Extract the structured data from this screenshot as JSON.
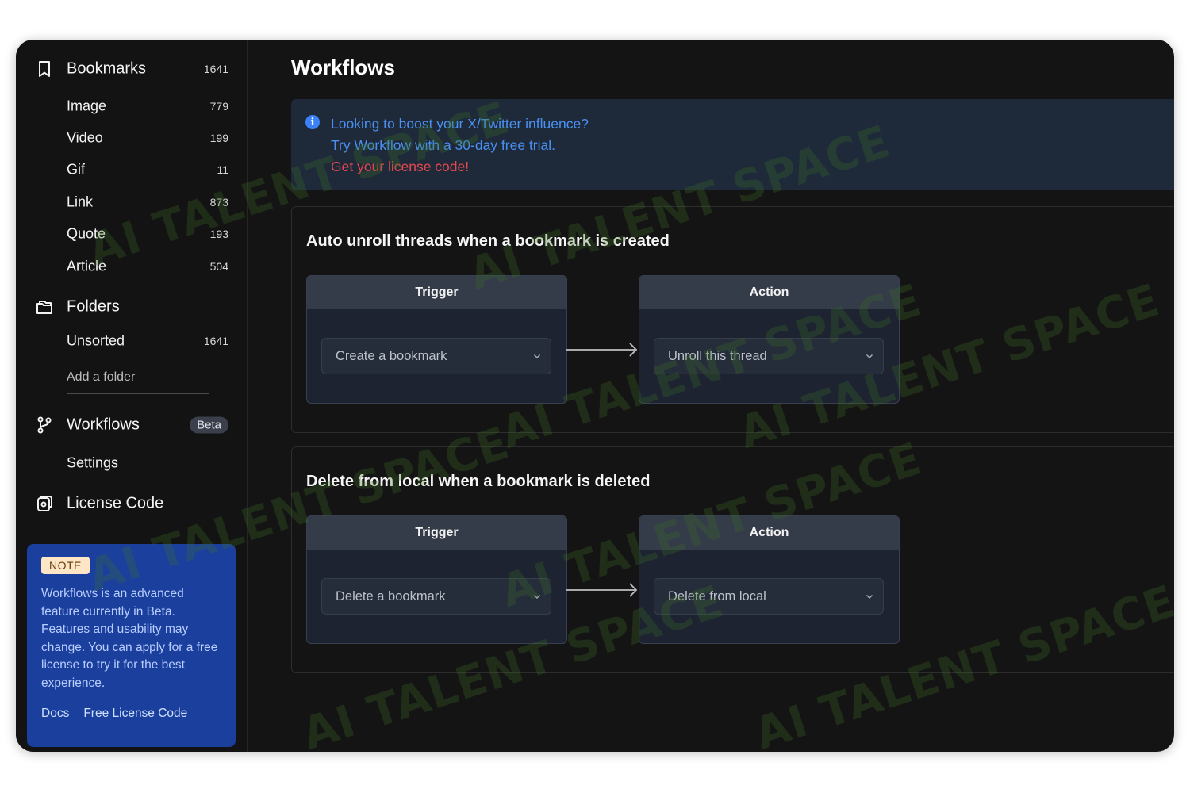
{
  "sidebar": {
    "bookmarks": {
      "label": "Bookmarks",
      "count": "1641"
    },
    "items": [
      {
        "label": "Image",
        "count": "779"
      },
      {
        "label": "Video",
        "count": "199"
      },
      {
        "label": "Gif",
        "count": "11"
      },
      {
        "label": "Link",
        "count": "873"
      },
      {
        "label": "Quote",
        "count": "193"
      },
      {
        "label": "Article",
        "count": "504"
      }
    ],
    "folders": {
      "label": "Folders"
    },
    "unsorted": {
      "label": "Unsorted",
      "count": "1641"
    },
    "add_folder": "Add a folder",
    "workflows": {
      "label": "Workflows",
      "badge": "Beta"
    },
    "settings": "Settings",
    "license": "License Code",
    "note": {
      "badge": "NOTE",
      "text": "Workflows is an advanced feature currently in Beta. Features and usability may change. You can apply for a free license to try it for the best experience.",
      "links": [
        "Docs",
        "Free License Code"
      ]
    }
  },
  "main": {
    "title": "Workflows",
    "banner": {
      "line1": "Looking to boost your X/Twitter influence?",
      "line2": "Try Workflow with a 30-day free trial.",
      "line3": "Get your license code!"
    },
    "workflows": [
      {
        "title": "Auto unroll threads when a bookmark is created",
        "trigger_label": "Trigger",
        "trigger_value": "Create a bookmark",
        "action_label": "Action",
        "action_value": "Unroll this thread"
      },
      {
        "title": "Delete from local when a bookmark is deleted",
        "trigger_label": "Trigger",
        "trigger_value": "Delete a bookmark",
        "action_label": "Action",
        "action_value": "Delete from local"
      }
    ]
  },
  "watermark": "AI TALENT SPACE",
  "colors": {
    "background": "#141414",
    "accent_blue": "#4a90f0",
    "alert_red": "#e5484d",
    "note_bg": "#1b3f9d"
  }
}
